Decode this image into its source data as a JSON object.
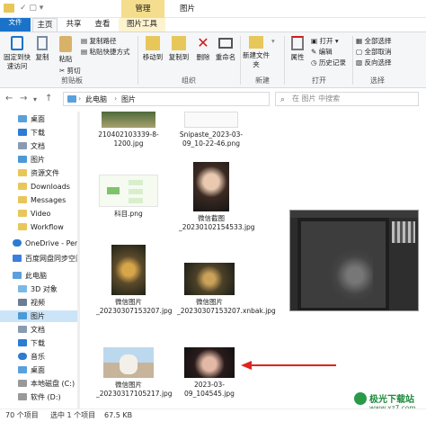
{
  "titlebar": {
    "contextual_tab": "管理",
    "window_title": "图片"
  },
  "tabs": {
    "file": "文件",
    "home": "主页",
    "share": "共享",
    "view": "查看",
    "picture_tools": "图片工具"
  },
  "ribbon": {
    "pin": "固定到快速访问",
    "copy": "复制",
    "paste": "粘贴",
    "copy_path": "复制路径",
    "paste_shortcut": "粘贴快捷方式",
    "cut": "剪切",
    "clipboard": "剪贴板",
    "move_to": "移动到",
    "copy_to": "复制到",
    "delete": "删除",
    "rename": "重命名",
    "organize": "组织",
    "new_folder": "新建文件夹",
    "new": "新建",
    "properties": "属性",
    "open": "打开",
    "edit": "编辑",
    "history": "历史记录",
    "open_group": "打开",
    "select_all": "全部选择",
    "select_none": "全部取消",
    "invert": "反向选择",
    "select": "选择"
  },
  "address": {
    "path_root": "此电脑",
    "path_leaf": "图片",
    "search_placeholder": "在 图片 中搜索"
  },
  "sidebar": {
    "items": [
      "桌面",
      "下载",
      "文档",
      "图片",
      "资源文件",
      "Downloads",
      "Messages",
      "Video",
      "Workflow",
      "OneDrive - Perso",
      "百度网盘同步空间",
      "此电脑",
      "3D 对象",
      "视频",
      "图片",
      "文档",
      "下载",
      "音乐",
      "桌面",
      "本地磁盘 (C:)",
      "软件 (D:)"
    ]
  },
  "files": [
    {
      "name": "210402103339-8-1200.jpg"
    },
    {
      "name": "Snipaste_2023-03-09_10-22-46.png"
    },
    {
      "name": "科目.png"
    },
    {
      "name": "微信截图_20230102154533.jpg"
    },
    {
      "name": "微信图片_20230307153207.jpg"
    },
    {
      "name": "微信图片_20230307153207.xnbak.jpg"
    },
    {
      "name": "微信图片_20230317105217.jpg"
    },
    {
      "name": "2023-03-09_104545.jpg"
    }
  ],
  "status": {
    "count": "70 个项目",
    "selected": "选中 1 个项目",
    "size": "67.5 KB"
  },
  "watermark": {
    "name": "极光下载站",
    "url": "www.xz7.com"
  },
  "colors": {
    "accent": "#1a73c9",
    "selected_bg": "#cce4f7",
    "arrow": "#e0241f",
    "manage_tab": "#e8c75a"
  }
}
